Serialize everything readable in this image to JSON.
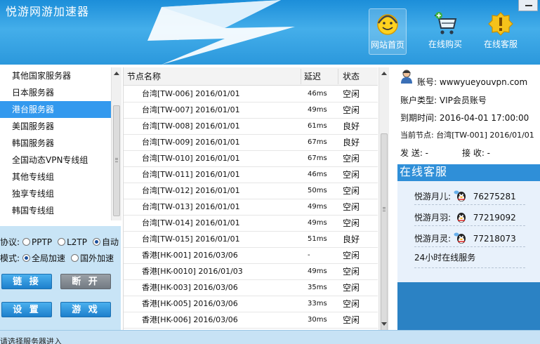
{
  "app": {
    "title": "悦游网游加速器"
  },
  "nav": {
    "home": {
      "label": "网站首页",
      "icon": "smiley-headset-icon"
    },
    "buy": {
      "label": "在线购买",
      "icon": "shopping-cart-icon"
    },
    "service": {
      "label": "在线客服",
      "icon": "gold-badge-icon"
    }
  },
  "server_groups": [
    {
      "label": "其他国家服务器"
    },
    {
      "label": "日本服务器"
    },
    {
      "label": "港台服务器",
      "selected": true
    },
    {
      "label": "美国服务器"
    },
    {
      "label": "韩国服务器"
    },
    {
      "label": "全国动态VPN专线组"
    },
    {
      "label": "其他专线组"
    },
    {
      "label": "独享专线组"
    },
    {
      "label": "韩国专线组"
    }
  ],
  "options": {
    "protocol": {
      "label": "协议:",
      "choices": [
        "PPTP",
        "L2TP",
        "自动"
      ],
      "selected": "自动"
    },
    "mode": {
      "label": "模式:",
      "choices": [
        "全局加速",
        "国外加速"
      ],
      "selected": "全局加速"
    }
  },
  "buttons": {
    "connect": "链 接",
    "disconnect": "断 开",
    "settings": "设 置",
    "games": "游 戏"
  },
  "table": {
    "headers": {
      "name": "节点名称",
      "latency": "延迟",
      "status": "状态"
    },
    "rows": [
      {
        "name": "台湾[TW-006] 2016/01/01",
        "latency": "46ms",
        "status": "空闲"
      },
      {
        "name": "台湾[TW-007] 2016/01/01",
        "latency": "49ms",
        "status": "空闲"
      },
      {
        "name": "台湾[TW-008] 2016/01/01",
        "latency": "61ms",
        "status": "良好"
      },
      {
        "name": "台湾[TW-009] 2016/01/01",
        "latency": "67ms",
        "status": "良好"
      },
      {
        "name": "台湾[TW-010] 2016/01/01",
        "latency": "67ms",
        "status": "空闲"
      },
      {
        "name": "台湾[TW-011] 2016/01/01",
        "latency": "46ms",
        "status": "空闲"
      },
      {
        "name": "台湾[TW-012] 2016/01/01",
        "latency": "50ms",
        "status": "空闲"
      },
      {
        "name": "台湾[TW-013] 2016/01/01",
        "latency": "49ms",
        "status": "空闲"
      },
      {
        "name": "台湾[TW-014] 2016/01/01",
        "latency": "49ms",
        "status": "空闲"
      },
      {
        "name": "台湾[TW-015] 2016/01/01",
        "latency": "51ms",
        "status": "良好"
      },
      {
        "name": "香港[HK-001] 2016/03/06",
        "latency": "-",
        "status": "空闲"
      },
      {
        "name": "香港[HK-0010] 2016/01/03",
        "latency": "49ms",
        "status": "空闲"
      },
      {
        "name": "香港[HK-003] 2016/03/06",
        "latency": "35ms",
        "status": "空闲"
      },
      {
        "name": "香港[HK-005] 2016/03/06",
        "latency": "33ms",
        "status": "空闲"
      },
      {
        "name": "香港[HK-006] 2016/03/06",
        "latency": "30ms",
        "status": "空闲"
      }
    ]
  },
  "account": {
    "account_line": "账号: wwwyueyouvpn.com",
    "type_line": "账户类型: VIP会员账号",
    "expire_line": "到期时间: 2016-04-01 17:00:00",
    "node_line": "当前节点: 台湾[TW-001] 2016/01/01",
    "send_line": "发 送: -",
    "recv_line": "接 收: -"
  },
  "support": {
    "title": "在线客服",
    "contacts": [
      {
        "name": "悦游月儿:",
        "qq": "76275281"
      },
      {
        "name": "悦游月羽:",
        "qq": "77219092"
      },
      {
        "name": "悦游月灵:",
        "qq": "77218073"
      }
    ],
    "hours": "24小时在线服务"
  },
  "status_bar": {
    "text": "请选择服务器进入"
  },
  "colors": {
    "header": "#2b98dc",
    "selected": "#3399ee",
    "panel": "#c8e4f6",
    "support_title": "#2f8fd8"
  }
}
